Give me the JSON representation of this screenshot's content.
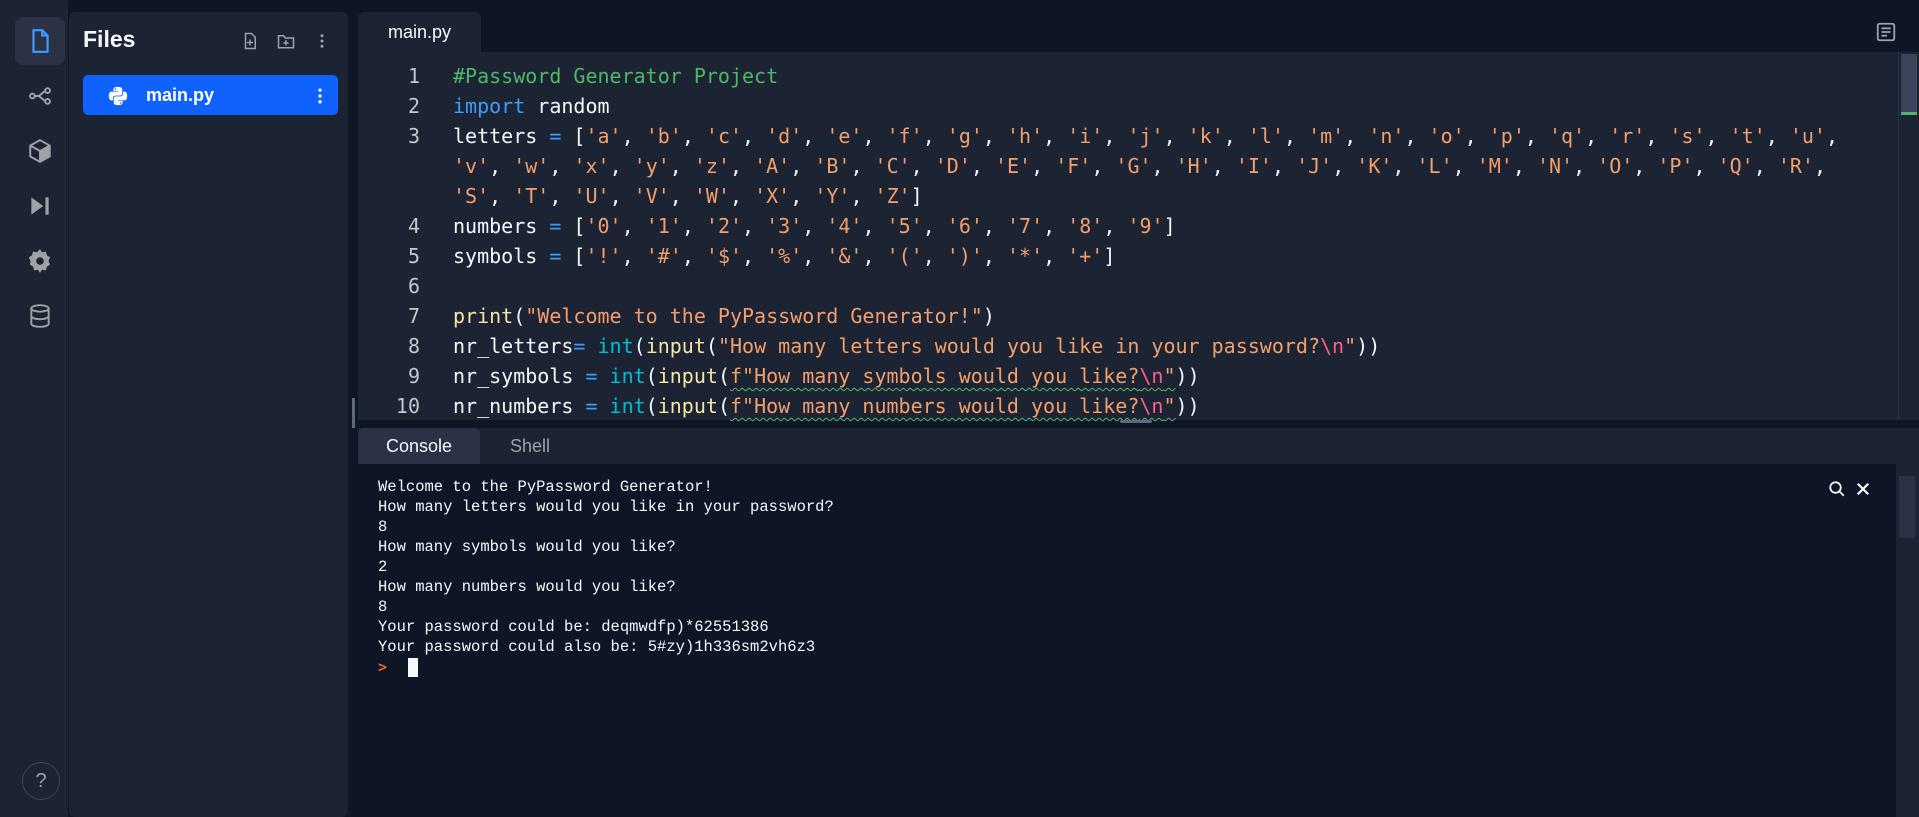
{
  "files_panel": {
    "title": "Files",
    "file_name": "main.py"
  },
  "editor": {
    "tab_label": "main.py",
    "line_numbers": [
      "1",
      "2",
      "3",
      "4",
      "5",
      "6",
      "7",
      "8",
      "9",
      "10"
    ],
    "lines": [
      "#Password Generator Project",
      "import random",
      "letters = ['a', 'b', 'c', 'd', 'e', 'f', 'g', 'h', 'i', 'j', 'k', 'l', 'm', 'n', 'o', 'p', 'q', 'r', 's', 't', 'u',",
      "'v', 'w', 'x', 'y', 'z', 'A', 'B', 'C', 'D', 'E', 'F', 'G', 'H', 'I', 'J', 'K', 'L', 'M', 'N', 'O', 'P', 'Q', 'R',",
      "'S', 'T', 'U', 'V', 'W', 'X', 'Y', 'Z']",
      "numbers = ['0', '1', '2', '3', '4', '5', '6', '7', '8', '9']",
      "symbols = ['!', '#', '$', '%', '&', '(', ')', '*', '+']",
      "",
      "print(\"Welcome to the PyPassword Generator!\")",
      "nr_letters= int(input(\"How many letters would you like in your password?\\n\"))",
      "nr_symbols = int(input(f\"How many symbols would you like?\\n\"))",
      "nr_numbers = int(input(f\"How many numbers would you like?\\n\"))"
    ]
  },
  "console": {
    "tabs": [
      "Console",
      "Shell"
    ],
    "output": [
      "Welcome to the PyPassword Generator!",
      "How many letters would you like in your password?",
      "8",
      "How many symbols would you like?",
      "2",
      "How many numbers would you like?",
      "8",
      "Your password could be: deqmwdfp)*62551386",
      "Your password could also be: 5#zy)1h336sm2vh6z3"
    ],
    "prompt": ">"
  },
  "help": {
    "label": "?"
  },
  "colors": {
    "background": "#0e1525",
    "panel": "#1c2333",
    "accent": "#0f62fe",
    "comment": "#4fb866",
    "keyword": "#3d9cff",
    "string": "#f29f6c",
    "builtin": "#00c0d6",
    "escape": "#ff5c8a",
    "prompt": "#f26522"
  },
  "icons": [
    "file-icon",
    "git-branch-icon",
    "package-icon",
    "run-icon",
    "settings-icon",
    "database-icon",
    "new-file-icon",
    "new-folder-icon",
    "more-icon",
    "python-icon",
    "search-icon",
    "close-icon",
    "layout-icon"
  ]
}
